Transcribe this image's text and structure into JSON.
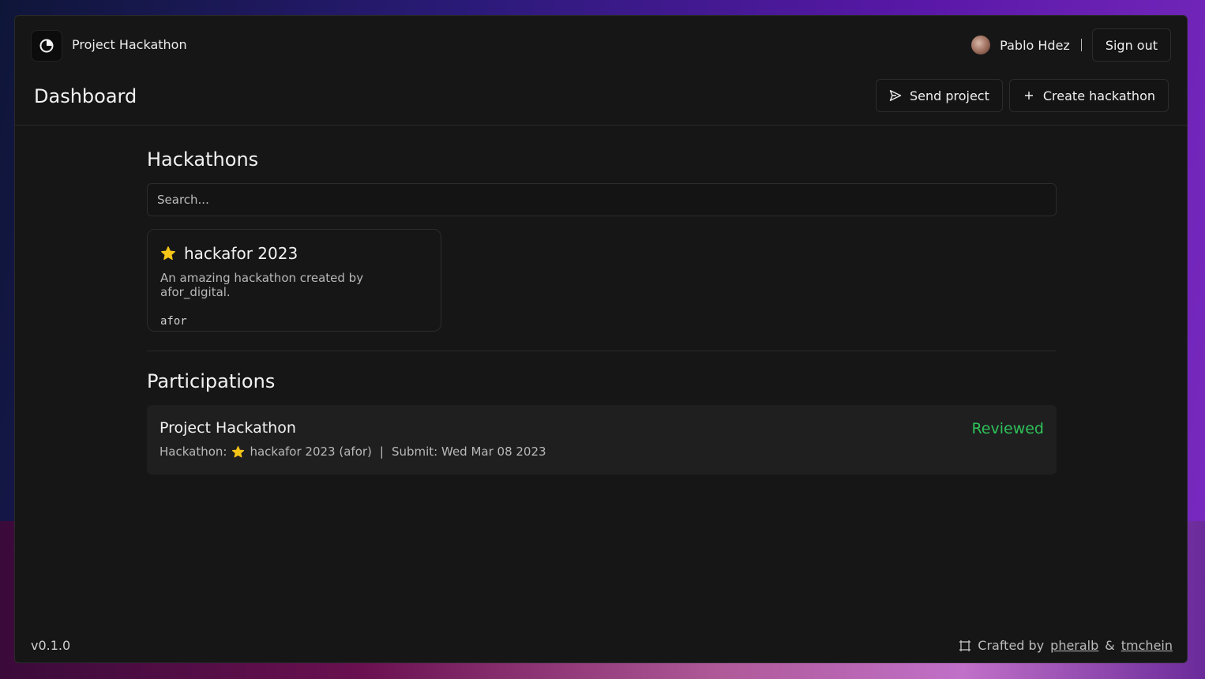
{
  "app": {
    "title": "Project Hackathon"
  },
  "user": {
    "name": "Pablo Hdez",
    "sign_out_label": "Sign out"
  },
  "header": {
    "title": "Dashboard",
    "send_project_label": "Send project",
    "create_hackathon_label": "Create hackathon"
  },
  "hackathons": {
    "title": "Hackathons",
    "search_placeholder": "Search...",
    "items": [
      {
        "name": "hackafor 2023",
        "description": "An amazing hackathon created by afor_digital.",
        "tag": "afor"
      }
    ]
  },
  "participations": {
    "title": "Participations",
    "items": [
      {
        "project": "Project Hackathon",
        "hackathon_label": "Hackathon:",
        "hackathon_name": "hackafor 2023 (afor)",
        "submit_text": "Submit: Wed Mar 08 2023",
        "status": "Reviewed"
      }
    ]
  },
  "footer": {
    "version": "v0.1.0",
    "crafted_by": "Crafted by",
    "author1": "pheralb",
    "amp": "&",
    "author2": "tmchein"
  },
  "colors": {
    "status_reviewed": "#2ec25a",
    "star": "#f5c518"
  },
  "icons": {
    "logo": "circle-logo-icon",
    "send": "send-icon",
    "plus": "plus-icon",
    "star": "star-icon",
    "frame": "frame-icon"
  }
}
